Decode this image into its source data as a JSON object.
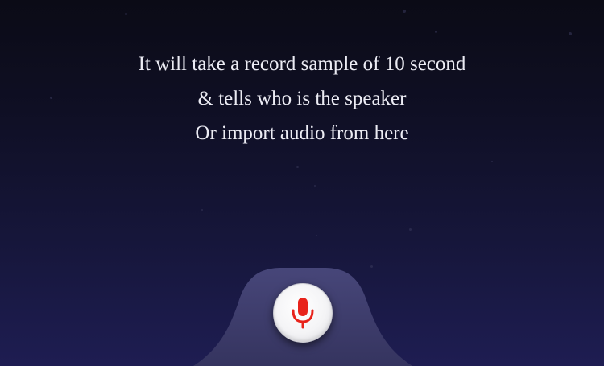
{
  "message": {
    "line1": "It will take a record sample of 10 second",
    "line2": "& tells who is the speaker",
    "line3": "Or import audio from here"
  },
  "record_button": {
    "icon": "microphone-icon",
    "icon_color": "#e8231b"
  },
  "colors": {
    "background_top": "#0b0b16",
    "background_bottom": "#1e1d52",
    "dock": "#3b3a6a",
    "text": "#ececf4"
  }
}
